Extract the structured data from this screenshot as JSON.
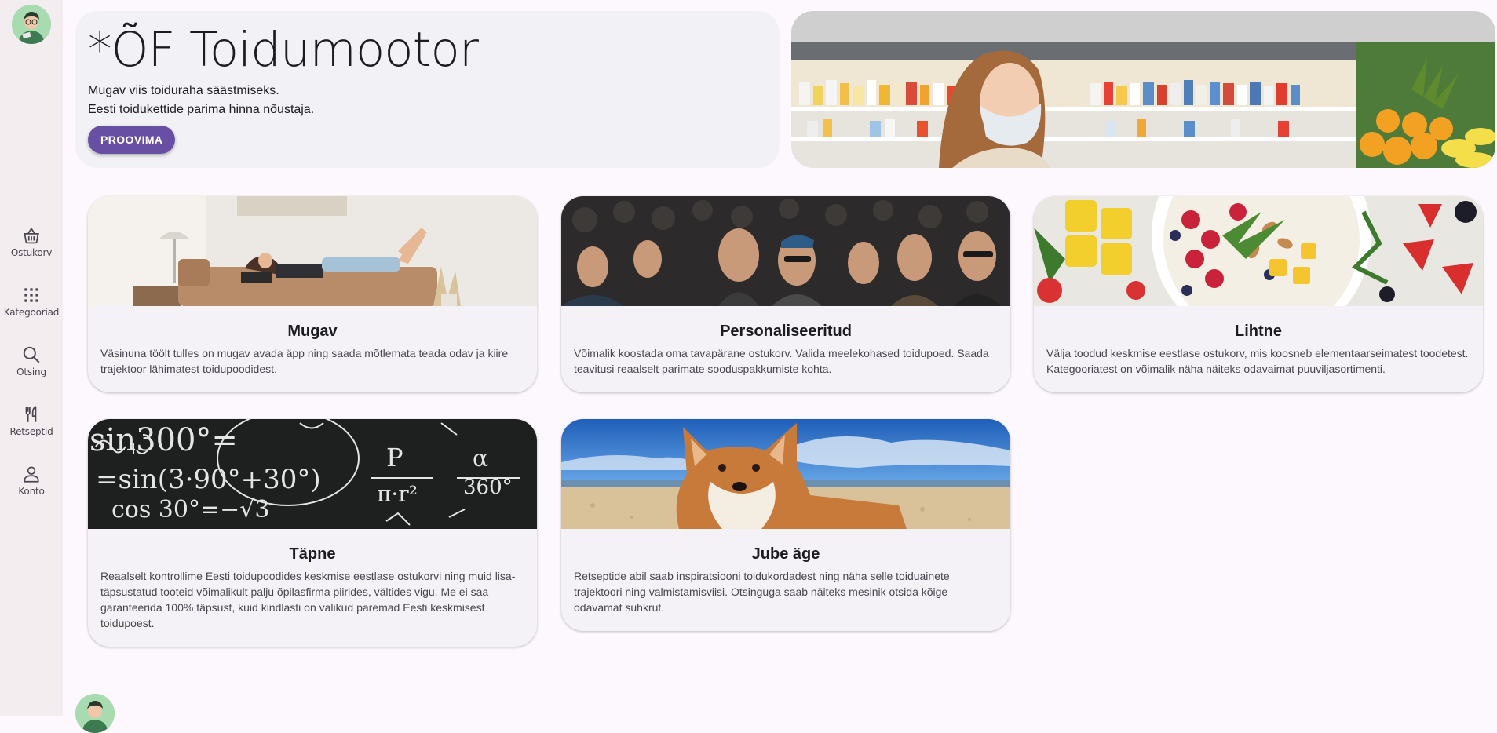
{
  "nav": {
    "items": [
      {
        "label": "Ostukorv",
        "icon": "basket-icon"
      },
      {
        "label": "Kategooriad",
        "icon": "apps-grid-icon"
      },
      {
        "label": "Otsing",
        "icon": "search-icon"
      },
      {
        "label": "Retseptid",
        "icon": "restaurant-icon"
      },
      {
        "label": "Konto",
        "icon": "person-icon"
      }
    ]
  },
  "hero": {
    "title": "*ÕF Toidumootor",
    "tagline_1": "Mugav viis toiduraha säästmiseks.",
    "tagline_2": "Eesti toidukettide parima hinna nõustaja.",
    "cta_label": "PROOVIMA"
  },
  "features": [
    {
      "title": "Mugav",
      "text": "Väsinuna töölt tulles on mugav avada äpp ning saada mõtlemata teada odav ja kiire trajektoor lähimatest toidupoodidest."
    },
    {
      "title": "Personaliseeritud",
      "text": "Võimalik koostada oma tavapärane ostukorv. Valida meelekohased toidupoed. Saada teavitusi reaalselt parimate sooduspakkumiste kohta."
    },
    {
      "title": "Lihtne",
      "text": "Välja toodud keskmise eestlase ostukorv, mis koosneb elementaarseimatest toodetest. Kategooriatest on võimalik näha näiteks odavaimat puuviljasortimenti."
    },
    {
      "title": "Täpne",
      "text": "Reaalselt kontrollime Eesti toidupoodides keskmise eestlase ostukorvi ning muid lisa-täpsustatud tooteid võimalikult palju õpilasfirma piirides, vältides vigu. Me ei saa garanteerida 100% täpsust, kuid kindlasti on valikud paremad Eesti keskmisest toidupoest."
    },
    {
      "title": "Jube äge",
      "text": "Retseptide abil saab inspiratsiooni toidukordadest ning näha selle toiduainete trajektoori ning valmistamisviisi. Otsinguga saab näiteks mesinik otsida kõige odavamat suhkrut."
    }
  ],
  "colors": {
    "primary": "#6750a4",
    "surface": "#f4f2f7",
    "rail": "#f3edf0"
  }
}
